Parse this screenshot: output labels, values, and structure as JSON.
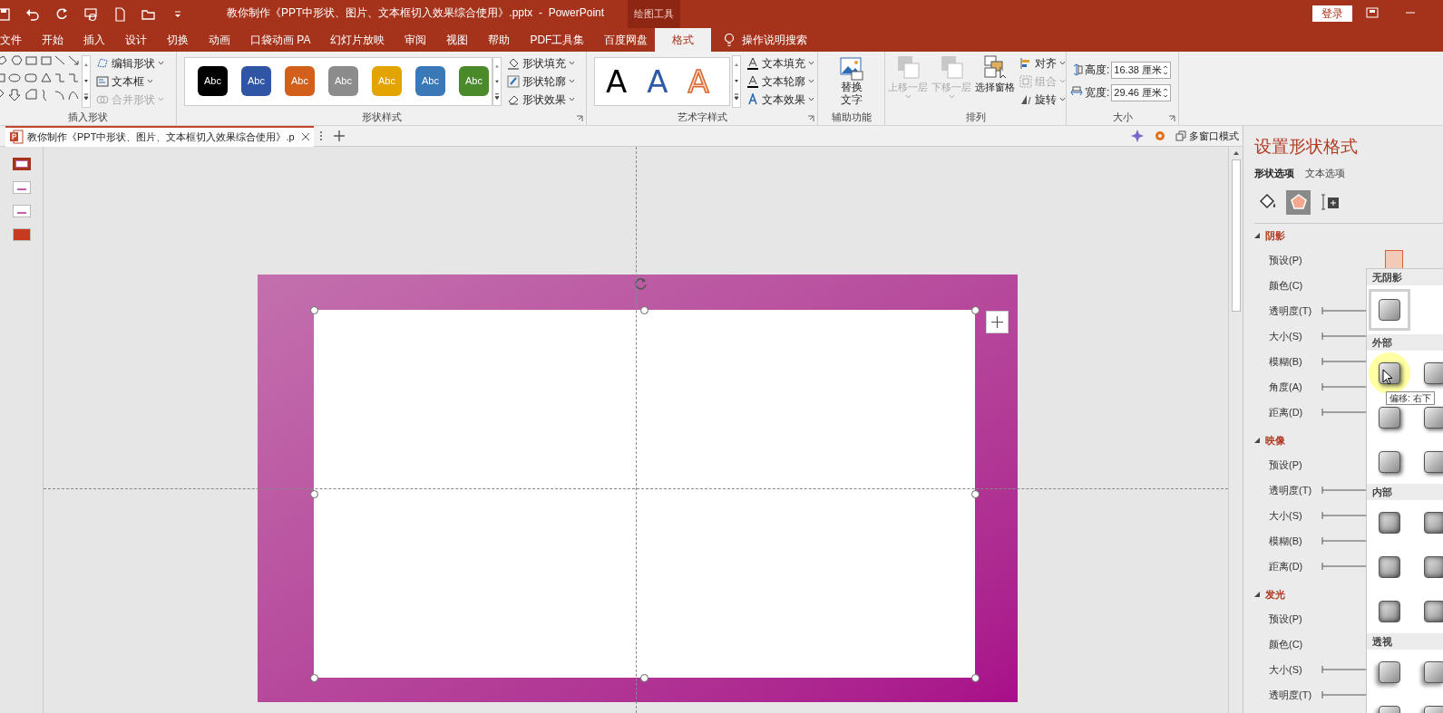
{
  "title_bar": {
    "title": "教你制作《PPT中形状、图片、文本框切入效果综合使用》.pptx  -  PowerPoint",
    "context_tab": "绘图工具",
    "login": "登录"
  },
  "menu_tabs": [
    {
      "label": "文件",
      "selected": false
    },
    {
      "label": "开始",
      "selected": false
    },
    {
      "label": "插入",
      "selected": false
    },
    {
      "label": "设计",
      "selected": false
    },
    {
      "label": "切换",
      "selected": false
    },
    {
      "label": "动画",
      "selected": false
    },
    {
      "label": "口袋动画 PA",
      "selected": false
    },
    {
      "label": "幻灯片放映",
      "selected": false
    },
    {
      "label": "审阅",
      "selected": false
    },
    {
      "label": "视图",
      "selected": false
    },
    {
      "label": "帮助",
      "selected": false
    },
    {
      "label": "PDF工具集",
      "selected": false
    },
    {
      "label": "百度网盘",
      "selected": false
    },
    {
      "label": "格式",
      "selected": true
    }
  ],
  "search": "操作说明搜索",
  "ribbon": {
    "insert_shapes": {
      "label": "插入形状",
      "buttons": [
        {
          "label": "编辑形状",
          "disabled": false
        },
        {
          "label": "文本框",
          "disabled": false
        },
        {
          "label": "合并形状",
          "disabled": true
        }
      ]
    },
    "shape_styles": {
      "label": "形状样式",
      "swatches": [
        {
          "label": "Abc",
          "color": "#000000"
        },
        {
          "label": "Abc",
          "color": "#2f55a4"
        },
        {
          "label": "Abc",
          "color": "#d2601a"
        },
        {
          "label": "Abc",
          "color": "#8c8c8c"
        },
        {
          "label": "Abc",
          "color": "#e3a400"
        },
        {
          "label": "Abc",
          "color": "#3a78b8"
        },
        {
          "label": "Abc",
          "color": "#4a8a2a"
        }
      ],
      "buttons": [
        {
          "label": "形状填充"
        },
        {
          "label": "形状轮廓"
        },
        {
          "label": "形状效果"
        }
      ]
    },
    "wordart": {
      "label": "艺术字样式",
      "samples": [
        {
          "label": "A",
          "kind": "black"
        },
        {
          "label": "A",
          "kind": "blue"
        },
        {
          "label": "A",
          "kind": "outline"
        }
      ],
      "buttons": [
        {
          "label": "文本填充"
        },
        {
          "label": "文本轮廓"
        },
        {
          "label": "文本效果"
        }
      ]
    },
    "accessibility": {
      "label": "辅助功能",
      "button": "替换文字"
    },
    "arrange": {
      "label": "排列",
      "large_buttons": [
        {
          "label": "上移一层",
          "disabled": true
        },
        {
          "label": "下移一层",
          "disabled": true
        },
        {
          "label": "选择窗格",
          "disabled": false
        }
      ],
      "small_buttons": [
        {
          "label": "对齐",
          "disabled": false
        },
        {
          "label": "组合",
          "disabled": true
        },
        {
          "label": "旋转",
          "disabled": false
        }
      ]
    },
    "size": {
      "label": "大小",
      "fields": [
        {
          "label": "高度:",
          "value": "16.38 厘米"
        },
        {
          "label": "宽度:",
          "value": "29.46 厘米"
        }
      ]
    }
  },
  "document_tab": {
    "title": "教你制作《PPT中形状、图片、文本框切入效果综合使用》.p",
    "multi_window": "多窗口模式"
  },
  "thumbnails": [
    {
      "kind": "frame",
      "selected": true
    },
    {
      "kind": "title",
      "selected": false
    },
    {
      "kind": "title",
      "selected": false
    },
    {
      "kind": "red",
      "selected": false
    }
  ],
  "slide": {
    "shape_selected": true
  },
  "format_pane": {
    "title": "设置形状格式",
    "tabs": [
      {
        "label": "形状选项",
        "selected": true
      },
      {
        "label": "文本选项",
        "selected": false
      }
    ],
    "icon_tabs": [
      {
        "kind": "fill",
        "selected": false
      },
      {
        "kind": "effects",
        "selected": true
      },
      {
        "kind": "size",
        "selected": false
      }
    ],
    "sections": [
      {
        "title": "阴影",
        "expanded": true,
        "rows": [
          {
            "label": "预设(P)",
            "kind": "preset_open"
          },
          {
            "label": "颜色(C)",
            "kind": "color"
          },
          {
            "label": "透明度(T)",
            "kind": "slider"
          },
          {
            "label": "大小(S)",
            "kind": "slider"
          },
          {
            "label": "模糊(B)",
            "kind": "slider"
          },
          {
            "label": "角度(A)",
            "kind": "slider"
          },
          {
            "label": "距离(D)",
            "kind": "slider"
          }
        ]
      },
      {
        "title": "映像",
        "expanded": true,
        "rows": [
          {
            "label": "预设(P)",
            "kind": "preset"
          },
          {
            "label": "透明度(T)",
            "kind": "slider"
          },
          {
            "label": "大小(S)",
            "kind": "slider"
          },
          {
            "label": "模糊(B)",
            "kind": "slider"
          },
          {
            "label": "距离(D)",
            "kind": "slider"
          }
        ]
      },
      {
        "title": "发光",
        "expanded": true,
        "rows": [
          {
            "label": "预设(P)",
            "kind": "preset"
          },
          {
            "label": "颜色(C)",
            "kind": "color"
          },
          {
            "label": "大小(S)",
            "kind": "slider"
          },
          {
            "label": "透明度(T)",
            "kind": "slider"
          }
        ]
      }
    ]
  },
  "shadow_gallery": {
    "tooltip": "偏移: 右下",
    "groups": [
      {
        "title": "无阴影",
        "kind": "none",
        "presets": [
          {
            "selected": true,
            "hovered": false
          }
        ]
      },
      {
        "title": "外部",
        "kind": "outer",
        "presets": [
          {
            "selected": false,
            "hovered": true
          },
          {
            "selected": false,
            "hovered": false
          },
          {
            "selected": false,
            "hovered": false
          },
          {
            "selected": false,
            "hovered": false
          },
          {
            "selected": false,
            "hovered": false
          },
          {
            "selected": false,
            "hovered": false
          }
        ]
      },
      {
        "title": "内部",
        "kind": "inner",
        "presets": [
          {
            "selected": false,
            "hovered": false
          },
          {
            "selected": false,
            "hovered": false
          },
          {
            "selected": false,
            "hovered": false
          },
          {
            "selected": false,
            "hovered": false
          },
          {
            "selected": false,
            "hovered": false
          },
          {
            "selected": false,
            "hovered": false
          }
        ]
      },
      {
        "title": "透视",
        "kind": "perspective",
        "presets": [
          {
            "selected": false,
            "hovered": false
          },
          {
            "selected": false,
            "hovered": false
          },
          {
            "selected": false,
            "hovered": false
          },
          {
            "selected": false,
            "hovered": false
          }
        ]
      }
    ]
  }
}
